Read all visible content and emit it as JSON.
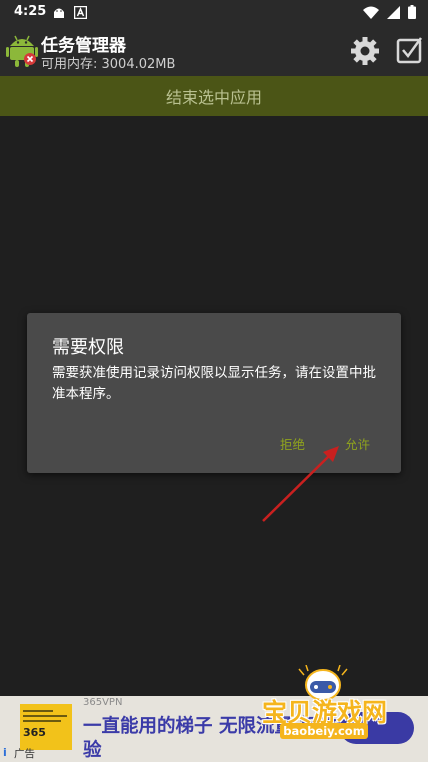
{
  "status_bar": {
    "time": "4:25",
    "left_icons": [
      "android-debug-icon",
      "a-notification-icon"
    ],
    "right_icons": [
      "wifi-icon",
      "cell-signal-icon",
      "battery-icon"
    ]
  },
  "app_bar": {
    "title": "任务管理器",
    "subtitle": "可用内存: 3004.02MB",
    "icons": [
      "android-app-icon",
      "settings-gear-icon",
      "checkbox-icon"
    ]
  },
  "end_button": {
    "label": "结束选中应用"
  },
  "dialog": {
    "title": "需要权限",
    "message": "需要获准使用记录访问权限以显示任务，请在设置中批准本程序。",
    "deny_label": "拒绝",
    "allow_label": "允许"
  },
  "ad": {
    "brand": "365VPN",
    "headline_1": "一直能用的梯子 无限流量 极致体",
    "headline_2": "验",
    "label": "广告",
    "image_text": "365"
  },
  "watermark": {
    "text": "宝贝游戏网",
    "url": "baobeiy.com"
  },
  "colors": {
    "accent": "#8fa31e",
    "end_button_bg": "#4b5516",
    "dialog_bg": "#4a4a4a",
    "screen_bg": "#1f1f1f",
    "arrow": "#c9201f"
  }
}
